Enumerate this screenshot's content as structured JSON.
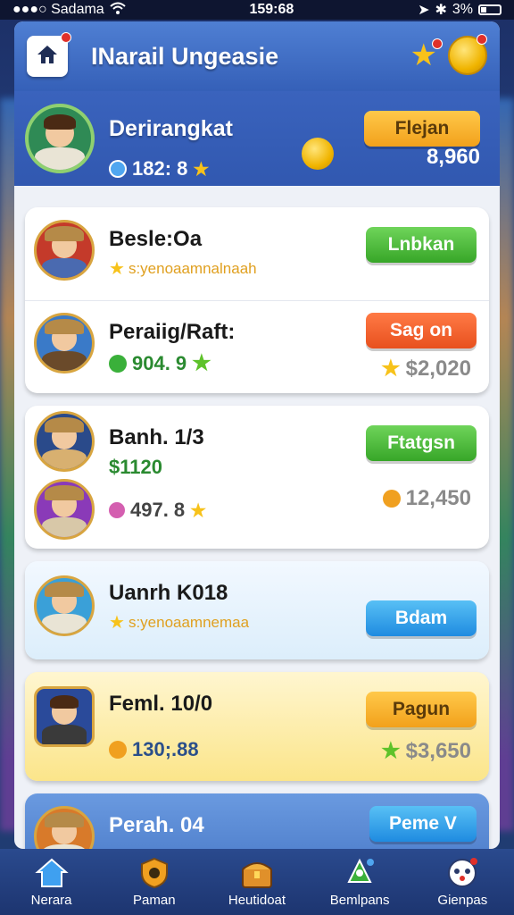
{
  "status_bar": {
    "carrier": "●●●○ Sadama",
    "time": "159:68",
    "battery": "3%"
  },
  "header": {
    "title": "INarail Ungeasie"
  },
  "profile": {
    "name": "Derirangkat",
    "level": "182: 8",
    "score": "8,960",
    "button_label": "Flejan"
  },
  "cards": [
    {
      "rows": [
        {
          "title": "Besle:Oa",
          "sub": "s:yenoaamnalnaah",
          "button_label": "Lnbkan",
          "button_color": "green"
        },
        {
          "title": "Peraiig/Raft:",
          "sub": "904. 9",
          "score": "$2,020",
          "button_label": "Sag on",
          "button_color": "red"
        }
      ]
    },
    {
      "rows": [
        {
          "title": "Banh. 1/3",
          "sub": "$1120",
          "button_label": "Ftatgsn",
          "button_color": "green"
        },
        {
          "title": "",
          "sub": "497. 8",
          "score": "12,450"
        }
      ]
    },
    {
      "rows": [
        {
          "title": "Uanrh K018",
          "sub": "s:yenoaamnemaa",
          "button_label": "Bdam",
          "button_color": "blue"
        }
      ]
    },
    {
      "rows": [
        {
          "title": "Feml. 10/0",
          "sub": "130;.88",
          "score": "$3,650",
          "button_label": "Pagun",
          "button_color": "orange"
        }
      ]
    },
    {
      "rows": [
        {
          "title": "Perah. 04",
          "button_label": "Peme V",
          "button_color": "blue"
        }
      ]
    }
  ],
  "nav": [
    {
      "label": "Nerara",
      "icon": "home-icon"
    },
    {
      "label": "Paman",
      "icon": "shield-icon"
    },
    {
      "label": "Heutidoat",
      "icon": "treasure-chest-icon"
    },
    {
      "label": "Bemlpans",
      "icon": "rocket-icon"
    },
    {
      "label": "Gienpas",
      "icon": "profile-icon"
    }
  ],
  "colors": {
    "header_blue": "#3560b8",
    "accent_gold": "#f0b400",
    "green_button": "#37a628",
    "orange_button": "#f2a11b"
  }
}
